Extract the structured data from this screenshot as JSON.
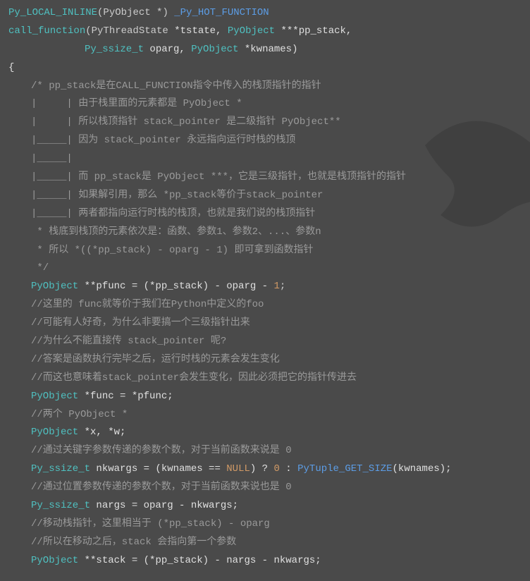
{
  "sig": {
    "l1_a": "Py_LOCAL_INLINE",
    "l1_b": "(PyObject *) ",
    "l1_c": "_Py_HOT_FUNCTION",
    "l2_a": "call_function",
    "l2_b": "(PyThreadState ",
    "l2_c": "*tstate, ",
    "l2_d": "PyObject ",
    "l2_e": "***pp_stack,",
    "l3_a": "Py_ssize_t ",
    "l3_b": "oparg, ",
    "l3_c": "PyObject ",
    "l3_d": "*kwnames)"
  },
  "brace_open": "{",
  "c": {
    "c01": "/* pp_stack是在CALL_FUNCTION指令中传入的栈顶指针的指针",
    "c02": "|     | 由于栈里面的元素都是 PyObject *",
    "c03": "|     | 所以栈顶指针 stack_pointer 是二级指针 PyObject**",
    "c04": "|_____| 因为 stack_pointer 永远指向运行时栈的栈顶",
    "c05": "|_____|",
    "c06": "|_____| 而 pp_stack是 PyObject ***，它是三级指针，也就是栈顶指针的指针",
    "c07": "|_____| 如果解引用，那么 *pp_stack等价于stack_pointer",
    "c08": "|_____| 两者都指向运行时栈的栈顶，也就是我们说的栈顶指针",
    "c09": " * 栈底到栈顶的元素依次是：函数、参数1、参数2、...、参数n",
    "c10": " * 所以 *((*pp_stack) - oparg - 1) 即可拿到函数指针",
    "c11": " */",
    "c12": "//这里的 func就等价于我们在Python中定义的foo",
    "c13": "//可能有人好奇，为什么非要搞一个三级指针出来",
    "c14": "//为什么不能直接传 stack_pointer 呢?",
    "c15": "//答案是函数执行完毕之后，运行时栈的元素会发生变化",
    "c16": "//而这也意味着stack_pointer会发生变化，因此必须把它的指针传进去",
    "c17": "//两个 PyObject *",
    "c18": "//通过关键字参数传递的参数个数，对于当前函数来说是 0",
    "c19": "//通过位置参数传递的参数个数，对于当前函数来说也是 0",
    "c20": "//移动栈指针，这里相当于 (*pp_stack) - oparg",
    "c21": "//所以在移动之后，stack 会指向第一个参数"
  },
  "code": {
    "pfunc_ty": "PyObject ",
    "pfunc_rest": "**pfunc = (*pp_stack) - oparg - ",
    "one": "1",
    "semi": ";",
    "func_ty": "PyObject ",
    "func_rest": "*func = *pfunc;",
    "xw_ty": "PyObject ",
    "xw_rest": "*x, *w;",
    "nkwargs_ty": "Py_ssize_t ",
    "nkwargs_a": "nkwargs = (kwnames == ",
    "null": "NULL",
    "nkwargs_b": ") ? ",
    "zero": "0",
    "nkwargs_c": " : ",
    "gettuple": "PyTuple_GET_SIZE",
    "nkwargs_d": "(kwnames);",
    "nargs_ty": "Py_ssize_t ",
    "nargs_rest": "nargs = oparg - nkwargs;",
    "stack_ty": "PyObject ",
    "stack_rest": "**stack = (*pp_stack) - nargs - nkwargs;"
  }
}
